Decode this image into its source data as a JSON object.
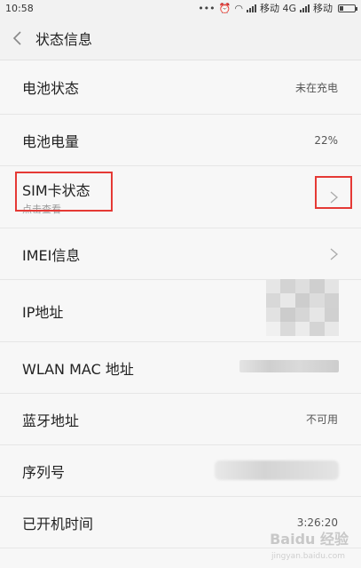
{
  "status_bar": {
    "time": "10:58",
    "carrier1": "移动 4G",
    "carrier2": "移动",
    "icons": [
      "more-dots-icon",
      "alarm-icon",
      "wifi-icon",
      "signal-icon",
      "battery-icon"
    ]
  },
  "header": {
    "back_icon": "chevron-left-icon",
    "title": "状态信息"
  },
  "rows": [
    {
      "label": "电池状态",
      "value": "未在充电"
    },
    {
      "label": "电池电量",
      "value": "22%"
    },
    {
      "label": "SIM卡状态",
      "sub": "点击查看",
      "chevron": true
    },
    {
      "label": "IMEI信息",
      "chevron": true
    },
    {
      "label": "IP地址",
      "value_obscured": true
    },
    {
      "label": "WLAN MAC 地址",
      "value_obscured": true
    },
    {
      "label": "蓝牙地址",
      "value": "不可用"
    },
    {
      "label": "序列号",
      "value_obscured": true
    },
    {
      "label": "已开机时间",
      "value": "3:26:20"
    }
  ],
  "highlight_color": "#e53935",
  "watermark": {
    "text": "Baidu 经验",
    "sub": "jingyan.baidu.com"
  }
}
